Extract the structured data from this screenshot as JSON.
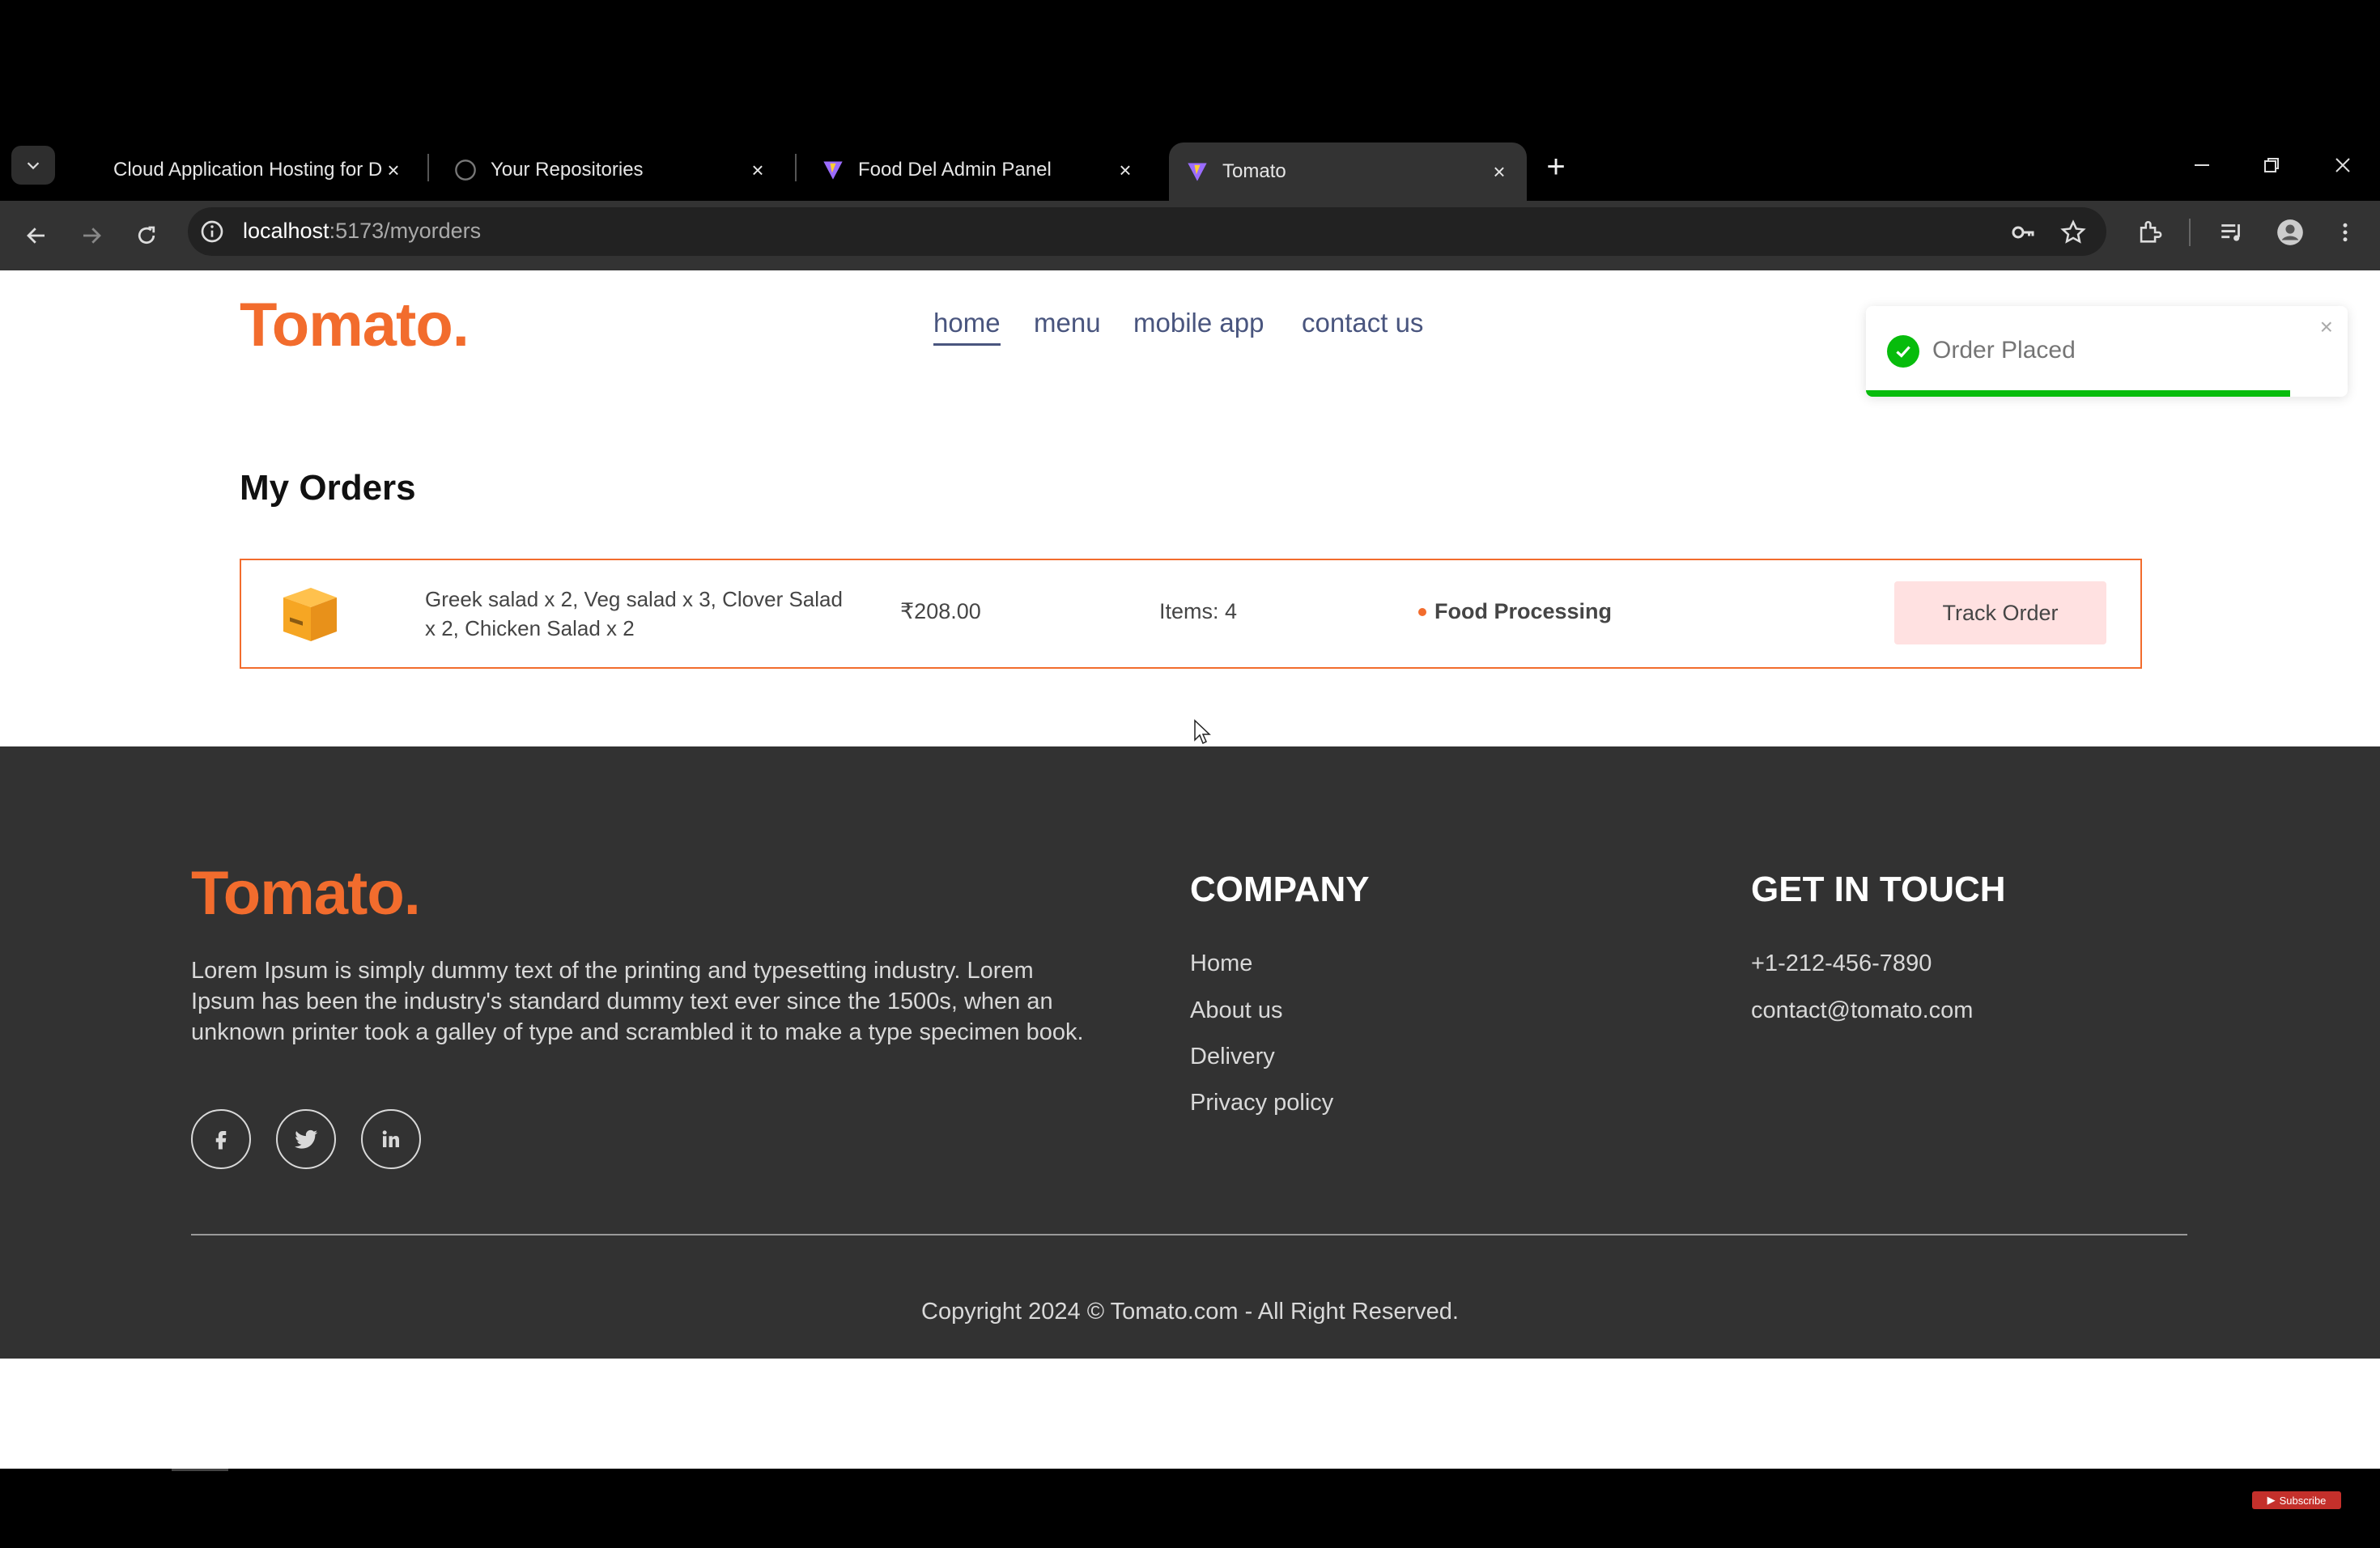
{
  "browser": {
    "tabs": [
      {
        "title": "Cloud Application Hosting for D",
        "icon": "render-icon"
      },
      {
        "title": "Your Repositories",
        "icon": "github-icon"
      },
      {
        "title": "Food Del Admin Panel",
        "icon": "vite-icon"
      },
      {
        "title": "Tomato",
        "icon": "vite-icon",
        "active": true
      }
    ],
    "url_host": "localhost",
    "url_path": ":5173/myorders"
  },
  "site": {
    "logo": "Tomato.",
    "nav": [
      "home",
      "menu",
      "mobile app",
      "contact us"
    ],
    "active_nav": "home"
  },
  "toast": {
    "message": "Order Placed",
    "progress": 0.88,
    "color": "#07bc0c"
  },
  "orders": {
    "title": "My Orders",
    "items": [
      {
        "summary": "Greek salad x 2, Veg salad x 3, Clover Salad x 2, Chicken Salad x 2",
        "amount": "₹208.00",
        "count": "Items: 4",
        "status": "Food Processing",
        "action": "Track Order"
      }
    ]
  },
  "footer": {
    "logo": "Tomato.",
    "description": "Lorem Ipsum is simply dummy text of the printing and typesetting industry. Lorem Ipsum has been the industry's standard dummy text ever since the 1500s, when an unknown printer took a galley of type and scrambled it to make a type specimen book.",
    "social": [
      "facebook-icon",
      "twitter-icon",
      "linkedin-icon"
    ],
    "company_heading": "COMPANY",
    "company_links": [
      "Home",
      "About us",
      "Delivery",
      "Privacy policy"
    ],
    "contact_heading": "GET IN TOUCH",
    "phone": "+1-212-456-7890",
    "email": "contact@tomato.com",
    "copyright": "Copyright 2024 © Tomato.com - All Right Reserved."
  },
  "overlay": {
    "subscribe": "Subscribe"
  },
  "colors": {
    "brand": "#f26c2d",
    "nav_text": "#49557e",
    "footer_bg": "#323232",
    "track_button_bg": "#ffe1e1"
  }
}
